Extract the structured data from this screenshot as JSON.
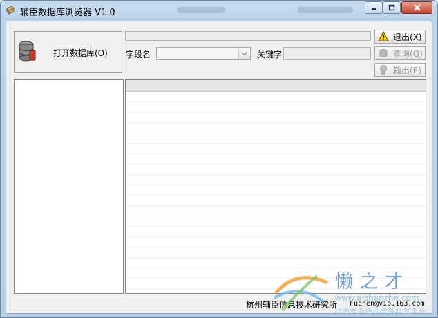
{
  "window": {
    "title": "辅臣数据库浏览器 V1.0"
  },
  "open_db": {
    "label": "打开数据库(O)"
  },
  "search": {
    "field_label": "字段名",
    "field_value": "",
    "keyword_label": "关键字",
    "keyword_value": ""
  },
  "actions": {
    "exit_label": "退出(X)",
    "query_label": "查询(Q)",
    "export_label": "输出(E)"
  },
  "footer": {
    "org": "杭州辅臣信息技术研究所",
    "email": "Fuchen@vip.163.com"
  },
  "watermark": {
    "brand": "懒之才",
    "url": "www.aizhanzhe.com",
    "slogan": "打造专业建站资源共享平台"
  },
  "colors": {
    "title_bg": "#bcd2ea",
    "client_bg": "#f0f0f0",
    "close_red": "#c6452e"
  }
}
